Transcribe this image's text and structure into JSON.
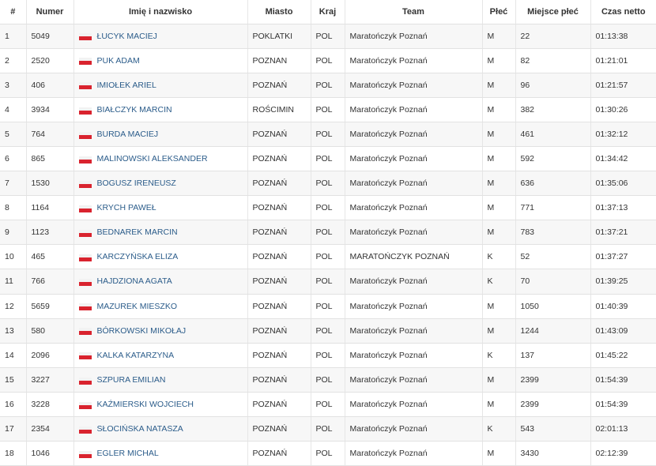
{
  "columns": [
    "#",
    "Numer",
    "Imię i nazwisko",
    "Miasto",
    "Kraj",
    "Team",
    "Płeć",
    "Miejsce płeć",
    "Czas netto"
  ],
  "rows": [
    {
      "pos": "1",
      "num": "5049",
      "name": "ŁUCYK MACIEJ",
      "city": "POKLATKI",
      "country": "POL",
      "team": "Maratończyk Poznań",
      "sex": "M",
      "place": "22",
      "time": "01:13:38"
    },
    {
      "pos": "2",
      "num": "2520",
      "name": "PUK ADAM",
      "city": "POZNAN",
      "country": "POL",
      "team": "Maratończyk Poznań",
      "sex": "M",
      "place": "82",
      "time": "01:21:01"
    },
    {
      "pos": "3",
      "num": "406",
      "name": "IMIOŁEK ARIEL",
      "city": "POZNAŃ",
      "country": "POL",
      "team": "Maratończyk Poznań",
      "sex": "M",
      "place": "96",
      "time": "01:21:57"
    },
    {
      "pos": "4",
      "num": "3934",
      "name": "BIAŁCZYK MARCIN",
      "city": "ROŚCIMIN",
      "country": "POL",
      "team": "Maratończyk Poznań",
      "sex": "M",
      "place": "382",
      "time": "01:30:26"
    },
    {
      "pos": "5",
      "num": "764",
      "name": "BURDA MACIEJ",
      "city": "POZNAŃ",
      "country": "POL",
      "team": "Maratończyk Poznań",
      "sex": "M",
      "place": "461",
      "time": "01:32:12"
    },
    {
      "pos": "6",
      "num": "865",
      "name": "MALINOWSKI ALEKSANDER",
      "city": "POZNAŃ",
      "country": "POL",
      "team": "Maratończyk Poznań",
      "sex": "M",
      "place": "592",
      "time": "01:34:42"
    },
    {
      "pos": "7",
      "num": "1530",
      "name": "BOGUSZ IRENEUSZ",
      "city": "POZNAŃ",
      "country": "POL",
      "team": "Maratończyk Poznań",
      "sex": "M",
      "place": "636",
      "time": "01:35:06"
    },
    {
      "pos": "8",
      "num": "1164",
      "name": "KRYCH PAWEŁ",
      "city": "POZNAŃ",
      "country": "POL",
      "team": "Maratończyk Poznań",
      "sex": "M",
      "place": "771",
      "time": "01:37:13"
    },
    {
      "pos": "9",
      "num": "1123",
      "name": "BEDNAREK MARCIN",
      "city": "POZNAŃ",
      "country": "POL",
      "team": "Maratończyk Poznań",
      "sex": "M",
      "place": "783",
      "time": "01:37:21"
    },
    {
      "pos": "10",
      "num": "465",
      "name": "KARCZYŃSKA ELIZA",
      "city": "POZNAŃ",
      "country": "POL",
      "team": "MARATOŃCZYK POZNAŃ",
      "sex": "K",
      "place": "52",
      "time": "01:37:27"
    },
    {
      "pos": "11",
      "num": "766",
      "name": "HAJDZIONA AGATA",
      "city": "POZNAŃ",
      "country": "POL",
      "team": "Maratończyk Poznań",
      "sex": "K",
      "place": "70",
      "time": "01:39:25"
    },
    {
      "pos": "12",
      "num": "5659",
      "name": "MAZUREK MIESZKO",
      "city": "POZNAŃ",
      "country": "POL",
      "team": "Maratończyk Poznań",
      "sex": "M",
      "place": "1050",
      "time": "01:40:39"
    },
    {
      "pos": "13",
      "num": "580",
      "name": "BÓRKOWSKI MIKOŁAJ",
      "city": "POZNAŃ",
      "country": "POL",
      "team": "Maratończyk Poznań",
      "sex": "M",
      "place": "1244",
      "time": "01:43:09"
    },
    {
      "pos": "14",
      "num": "2096",
      "name": "KALKA KATARZYNA",
      "city": "POZNAŃ",
      "country": "POL",
      "team": "Maratończyk Poznań",
      "sex": "K",
      "place": "137",
      "time": "01:45:22"
    },
    {
      "pos": "15",
      "num": "3227",
      "name": "SZPURA EMILIAN",
      "city": "POZNAŃ",
      "country": "POL",
      "team": "Maratończyk Poznań",
      "sex": "M",
      "place": "2399",
      "time": "01:54:39"
    },
    {
      "pos": "16",
      "num": "3228",
      "name": "KAŹMIERSKI WOJCIECH",
      "city": "POZNAŃ",
      "country": "POL",
      "team": "Maratończyk Poznań",
      "sex": "M",
      "place": "2399",
      "time": "01:54:39"
    },
    {
      "pos": "17",
      "num": "2354",
      "name": "SŁOCIŃSKA NATASZA",
      "city": "POZNAŃ",
      "country": "POL",
      "team": "Maratończyk Poznań",
      "sex": "K",
      "place": "543",
      "time": "02:01:13"
    },
    {
      "pos": "18",
      "num": "1046",
      "name": "EGLER MICHAL",
      "city": "POZNAŃ",
      "country": "POL",
      "team": "Maratończyk Poznań",
      "sex": "M",
      "place": "3430",
      "time": "02:12:39"
    }
  ],
  "colors": {
    "link": "#2b5c8a",
    "stripe": "#f7f7f7",
    "flag_red": "#d9232e"
  },
  "icons": {
    "flag": "poland-flag-icon"
  }
}
